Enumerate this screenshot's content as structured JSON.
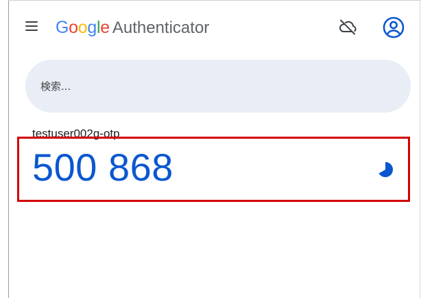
{
  "app": {
    "brand": {
      "G": "G",
      "o1": "o",
      "o2": "o",
      "g": "g",
      "l": "l",
      "e": "e"
    },
    "product": "Authenticator"
  },
  "icons": {
    "menu": "menu-icon",
    "cloud_off": "cloud-off-icon",
    "account": "account-circle-icon",
    "timer": "countdown-timer-icon"
  },
  "search": {
    "placeholder": "検索...",
    "value": ""
  },
  "entries": [
    {
      "account": "testuser002g-otp",
      "code": "500 868"
    }
  ],
  "colors": {
    "accent": "#0b57d0",
    "search_bg": "#e9eef6",
    "highlight": "#d40000"
  }
}
